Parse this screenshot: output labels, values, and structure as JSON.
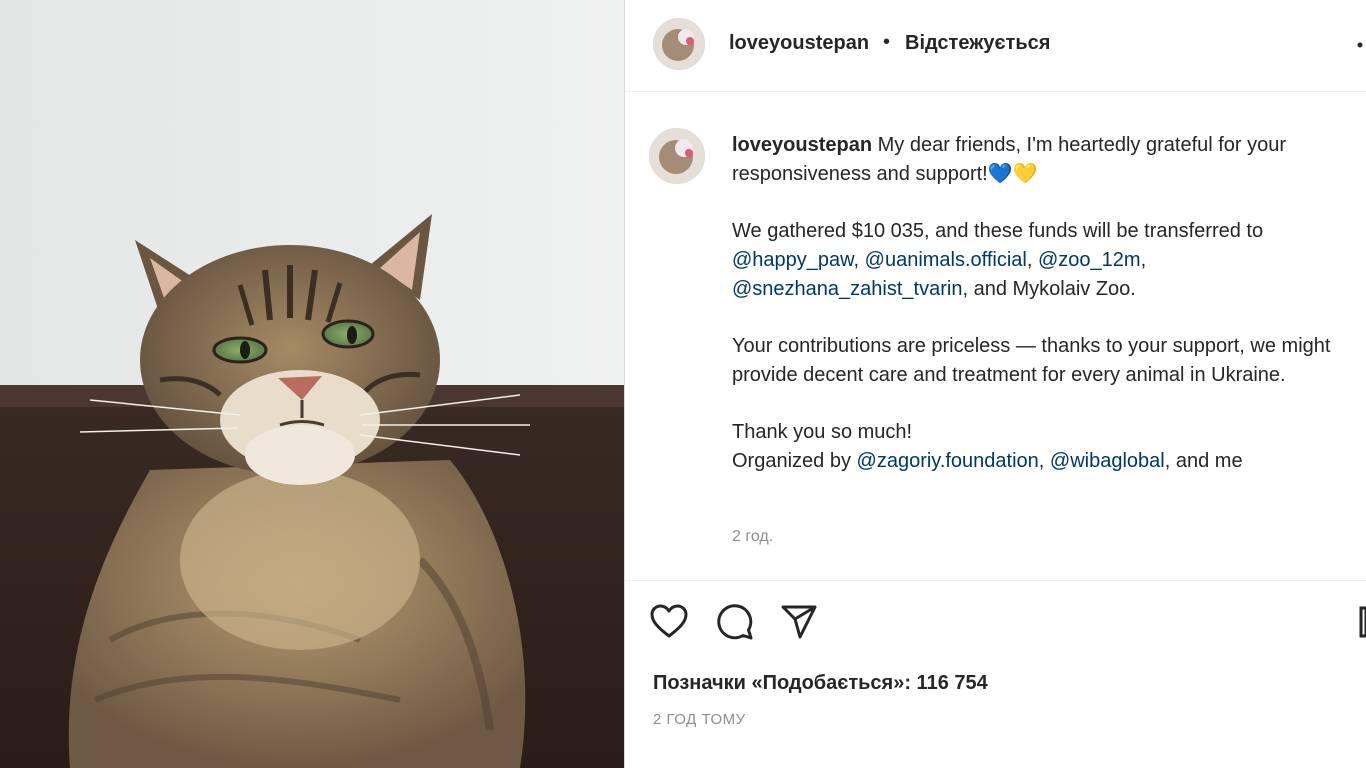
{
  "post": {
    "username": "loveyoustepan",
    "follow_status": "Відстежується",
    "separator": "•",
    "caption": {
      "line1_text": "My dear friends, I'm heartedly grateful for your responsiveness and support!",
      "hearts": "💙💛",
      "para2_pre": "We gathered $10 035, and these funds will be transferred to",
      "mentions_1": [
        "@happy_paw",
        "@uanimals.official",
        "@zoo_12m",
        "@snezhana_zahist_tvarin"
      ],
      "para2_post": ", and Mykolaiv Zoo.",
      "para3": "Your contributions are priceless — thanks to your support, we might provide decent care and treatment for every animal in Ukraine.",
      "para4_line1": "Thank you so much!",
      "para4_pre": "Organized by",
      "mentions_2": [
        "@zagoriy.foundation",
        "@wibaglobal"
      ],
      "para4_post": ", and me"
    },
    "caption_time": "2 год.",
    "likes_label": "Позначки «Подобається»: 116 754",
    "posted_time": "2 ГОД ТОМУ"
  },
  "icons": {
    "like": "heart-icon",
    "comment": "comment-bubble-icon",
    "share": "paper-plane-icon",
    "save": "bookmark-icon",
    "more": "more-options-icon"
  },
  "colors": {
    "text": "#262626",
    "mention": "#00376b",
    "secondary": "#8e8e8e",
    "border": "#efefef"
  }
}
